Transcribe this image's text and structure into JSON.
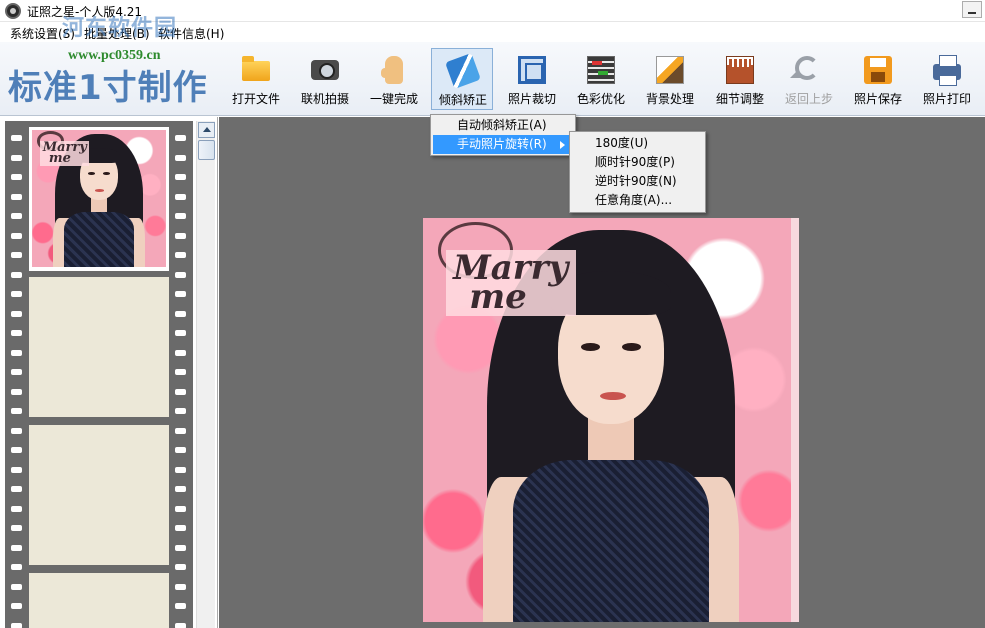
{
  "window": {
    "title": "证照之星-个人版4.21"
  },
  "menubar": {
    "items": [
      "系统设置(S)",
      "批量处理(B)",
      "软件信息(H)"
    ]
  },
  "watermark": {
    "site": "河东软件园",
    "url": "www.pc0359.cn"
  },
  "toolbar": {
    "brand": "标准1寸制作",
    "tools": [
      {
        "label": "打开文件",
        "icon": "folder-icon"
      },
      {
        "label": "联机拍摄",
        "icon": "camera-icon"
      },
      {
        "label": "一键完成",
        "icon": "hand-icon"
      },
      {
        "label": "倾斜矫正",
        "icon": "tilt-correct-icon"
      },
      {
        "label": "照片裁切",
        "icon": "crop-icon"
      },
      {
        "label": "色彩优化",
        "icon": "color-adjust-icon"
      },
      {
        "label": "背景处理",
        "icon": "background-icon"
      },
      {
        "label": "细节调整",
        "icon": "detail-icon"
      },
      {
        "label": "返回上步",
        "icon": "undo-icon"
      },
      {
        "label": "照片保存",
        "icon": "save-icon"
      },
      {
        "label": "照片打印",
        "icon": "printer-icon"
      }
    ]
  },
  "dropdown": {
    "items": [
      "自动倾斜矫正(A)",
      "手动照片旋转(R)"
    ]
  },
  "submenu": {
    "items": [
      "180度(U)",
      "顺时针90度(P)",
      "逆时针90度(N)",
      "任意角度(A)..."
    ]
  },
  "photo": {
    "caption_line1": "Marry",
    "caption_line2": "me"
  }
}
